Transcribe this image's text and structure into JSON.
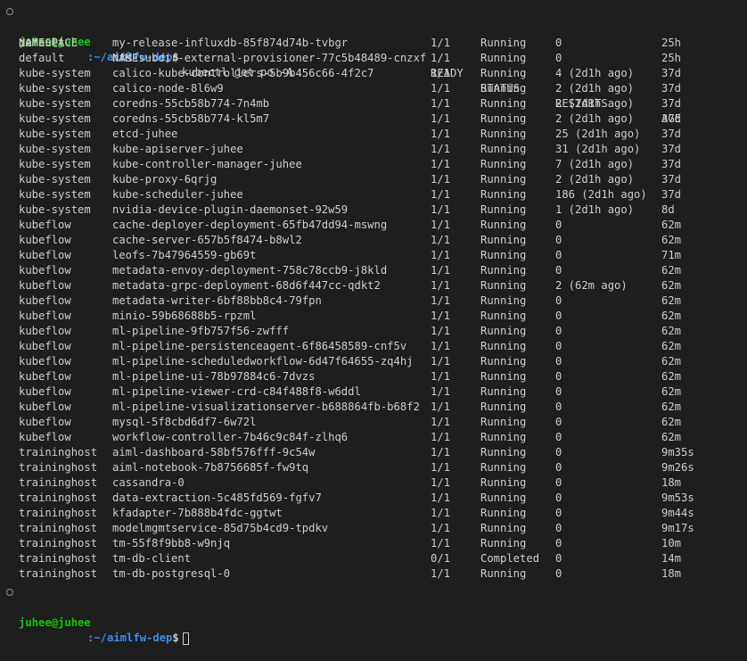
{
  "prompt": {
    "user_host": "juhee@juhee",
    "path": ":~/aimlfw-dep",
    "symbol": "$"
  },
  "command": "kubectl get po -A",
  "headers": {
    "namespace": "NAMESPACE",
    "name": "NAME",
    "ready": "READY",
    "status": "STATUS",
    "restarts": "RESTARTS",
    "age": "AGE"
  },
  "rows": [
    {
      "namespace": "default",
      "name": "my-release-influxdb-85f874d74b-tvbgr",
      "ready": "1/1",
      "status": "Running",
      "restarts": "0",
      "age": "25h"
    },
    {
      "namespace": "default",
      "name": "nfs-subdir-external-provisioner-77c5b48489-cnzxf",
      "ready": "1/1",
      "status": "Running",
      "restarts": "0",
      "age": "25h"
    },
    {
      "namespace": "kube-system",
      "name": "calico-kube-controllers-5b9b456c66-4f2c7",
      "ready": "1/1",
      "status": "Running",
      "restarts": "4 (2d1h ago)",
      "age": "37d"
    },
    {
      "namespace": "kube-system",
      "name": "calico-node-8l6w9",
      "ready": "1/1",
      "status": "Running",
      "restarts": "2 (2d1h ago)",
      "age": "37d"
    },
    {
      "namespace": "kube-system",
      "name": "coredns-55cb58b774-7n4mb",
      "ready": "1/1",
      "status": "Running",
      "restarts": "2 (2d1h ago)",
      "age": "37d"
    },
    {
      "namespace": "kube-system",
      "name": "coredns-55cb58b774-kl5m7",
      "ready": "1/1",
      "status": "Running",
      "restarts": "2 (2d1h ago)",
      "age": "37d"
    },
    {
      "namespace": "kube-system",
      "name": "etcd-juhee",
      "ready": "1/1",
      "status": "Running",
      "restarts": "25 (2d1h ago)",
      "age": "37d"
    },
    {
      "namespace": "kube-system",
      "name": "kube-apiserver-juhee",
      "ready": "1/1",
      "status": "Running",
      "restarts": "31 (2d1h ago)",
      "age": "37d"
    },
    {
      "namespace": "kube-system",
      "name": "kube-controller-manager-juhee",
      "ready": "1/1",
      "status": "Running",
      "restarts": "7 (2d1h ago)",
      "age": "37d"
    },
    {
      "namespace": "kube-system",
      "name": "kube-proxy-6qrjg",
      "ready": "1/1",
      "status": "Running",
      "restarts": "2 (2d1h ago)",
      "age": "37d"
    },
    {
      "namespace": "kube-system",
      "name": "kube-scheduler-juhee",
      "ready": "1/1",
      "status": "Running",
      "restarts": "186 (2d1h ago)",
      "age": "37d"
    },
    {
      "namespace": "kube-system",
      "name": "nvidia-device-plugin-daemonset-92w59",
      "ready": "1/1",
      "status": "Running",
      "restarts": "1 (2d1h ago)",
      "age": "8d"
    },
    {
      "namespace": "kubeflow",
      "name": "cache-deployer-deployment-65fb47dd94-mswng",
      "ready": "1/1",
      "status": "Running",
      "restarts": "0",
      "age": "62m"
    },
    {
      "namespace": "kubeflow",
      "name": "cache-server-657b5f8474-b8wl2",
      "ready": "1/1",
      "status": "Running",
      "restarts": "0",
      "age": "62m"
    },
    {
      "namespace": "kubeflow",
      "name": "leofs-7b47964559-gb69t",
      "ready": "1/1",
      "status": "Running",
      "restarts": "0",
      "age": "71m"
    },
    {
      "namespace": "kubeflow",
      "name": "metadata-envoy-deployment-758c78ccb9-j8kld",
      "ready": "1/1",
      "status": "Running",
      "restarts": "0",
      "age": "62m"
    },
    {
      "namespace": "kubeflow",
      "name": "metadata-grpc-deployment-68d6f447cc-qdkt2",
      "ready": "1/1",
      "status": "Running",
      "restarts": "2 (62m ago)",
      "age": "62m"
    },
    {
      "namespace": "kubeflow",
      "name": "metadata-writer-6bf88bb8c4-79fpn",
      "ready": "1/1",
      "status": "Running",
      "restarts": "0",
      "age": "62m"
    },
    {
      "namespace": "kubeflow",
      "name": "minio-59b68688b5-rpzml",
      "ready": "1/1",
      "status": "Running",
      "restarts": "0",
      "age": "62m"
    },
    {
      "namespace": "kubeflow",
      "name": "ml-pipeline-9fb757f56-zwfff",
      "ready": "1/1",
      "status": "Running",
      "restarts": "0",
      "age": "62m"
    },
    {
      "namespace": "kubeflow",
      "name": "ml-pipeline-persistenceagent-6f86458589-cnf5v",
      "ready": "1/1",
      "status": "Running",
      "restarts": "0",
      "age": "62m"
    },
    {
      "namespace": "kubeflow",
      "name": "ml-pipeline-scheduledworkflow-6d47f64655-zq4hj",
      "ready": "1/1",
      "status": "Running",
      "restarts": "0",
      "age": "62m"
    },
    {
      "namespace": "kubeflow",
      "name": "ml-pipeline-ui-78b97884c6-7dvzs",
      "ready": "1/1",
      "status": "Running",
      "restarts": "0",
      "age": "62m"
    },
    {
      "namespace": "kubeflow",
      "name": "ml-pipeline-viewer-crd-c84f488f8-w6ddl",
      "ready": "1/1",
      "status": "Running",
      "restarts": "0",
      "age": "62m"
    },
    {
      "namespace": "kubeflow",
      "name": "ml-pipeline-visualizationserver-b688864fb-b68f2",
      "ready": "1/1",
      "status": "Running",
      "restarts": "0",
      "age": "62m"
    },
    {
      "namespace": "kubeflow",
      "name": "mysql-5f8cbd6df7-6w72l",
      "ready": "1/1",
      "status": "Running",
      "restarts": "0",
      "age": "62m"
    },
    {
      "namespace": "kubeflow",
      "name": "workflow-controller-7b46c9c84f-zlhq6",
      "ready": "1/1",
      "status": "Running",
      "restarts": "0",
      "age": "62m"
    },
    {
      "namespace": "traininghost",
      "name": "aiml-dashboard-58bf576fff-9c54w",
      "ready": "1/1",
      "status": "Running",
      "restarts": "0",
      "age": "9m35s"
    },
    {
      "namespace": "traininghost",
      "name": "aiml-notebook-7b8756685f-fw9tq",
      "ready": "1/1",
      "status": "Running",
      "restarts": "0",
      "age": "9m26s"
    },
    {
      "namespace": "traininghost",
      "name": "cassandra-0",
      "ready": "1/1",
      "status": "Running",
      "restarts": "0",
      "age": "18m"
    },
    {
      "namespace": "traininghost",
      "name": "data-extraction-5c485fd569-fgfv7",
      "ready": "1/1",
      "status": "Running",
      "restarts": "0",
      "age": "9m53s"
    },
    {
      "namespace": "traininghost",
      "name": "kfadapter-7b888b4fdc-ggtwt",
      "ready": "1/1",
      "status": "Running",
      "restarts": "0",
      "age": "9m44s"
    },
    {
      "namespace": "traininghost",
      "name": "modelmgmtservice-85d75b4cd9-tpdkv",
      "ready": "1/1",
      "status": "Running",
      "restarts": "0",
      "age": "9m17s"
    },
    {
      "namespace": "traininghost",
      "name": "tm-55f8f9bb8-w9njq",
      "ready": "1/1",
      "status": "Running",
      "restarts": "0",
      "age": "10m"
    },
    {
      "namespace": "traininghost",
      "name": "tm-db-client",
      "ready": "0/1",
      "status": "Completed",
      "restarts": "0",
      "age": "14m"
    },
    {
      "namespace": "traininghost",
      "name": "tm-db-postgresql-0",
      "ready": "1/1",
      "status": "Running",
      "restarts": "0",
      "age": "18m"
    }
  ]
}
